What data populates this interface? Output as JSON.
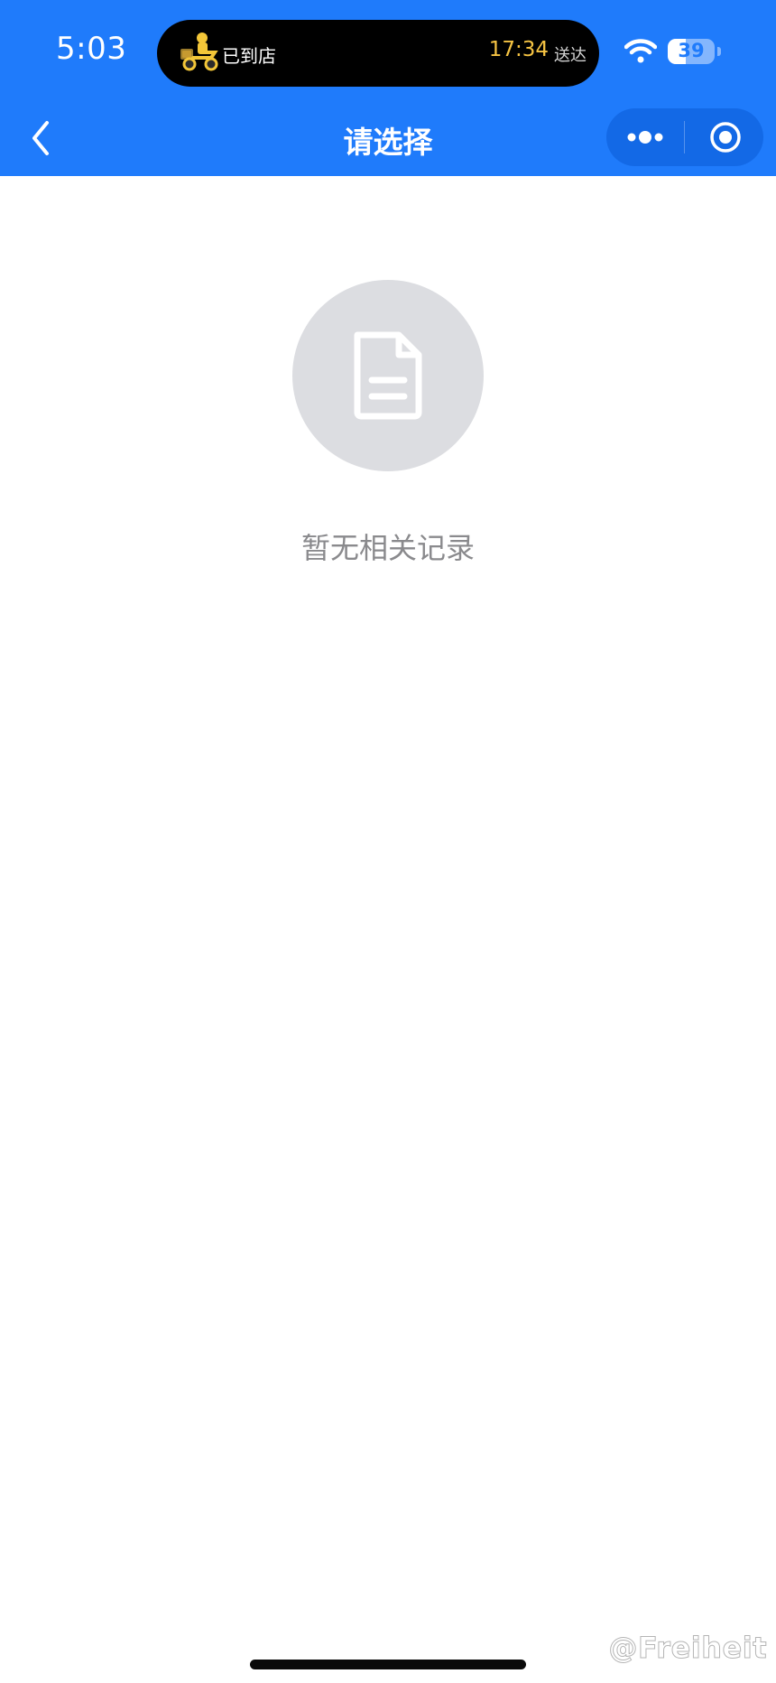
{
  "status_bar": {
    "time": "5:03",
    "battery_level": "39",
    "battery_fraction": 0.39,
    "live_activity": {
      "status": "已到店",
      "eta": "17:34",
      "eta_suffix": "送达"
    }
  },
  "nav_bar": {
    "title": "请选择",
    "more_icon": "more-dots-icon",
    "close_icon": "target-close-icon"
  },
  "empty_state": {
    "icon": "document-icon",
    "message": "暂无相关记录"
  },
  "watermark": "@Freiheit",
  "colors": {
    "header_bg": "#1f7bfb",
    "eta_accent": "#f6c443",
    "empty_circle": "#dcdde1",
    "empty_text": "#8a8a8d"
  }
}
